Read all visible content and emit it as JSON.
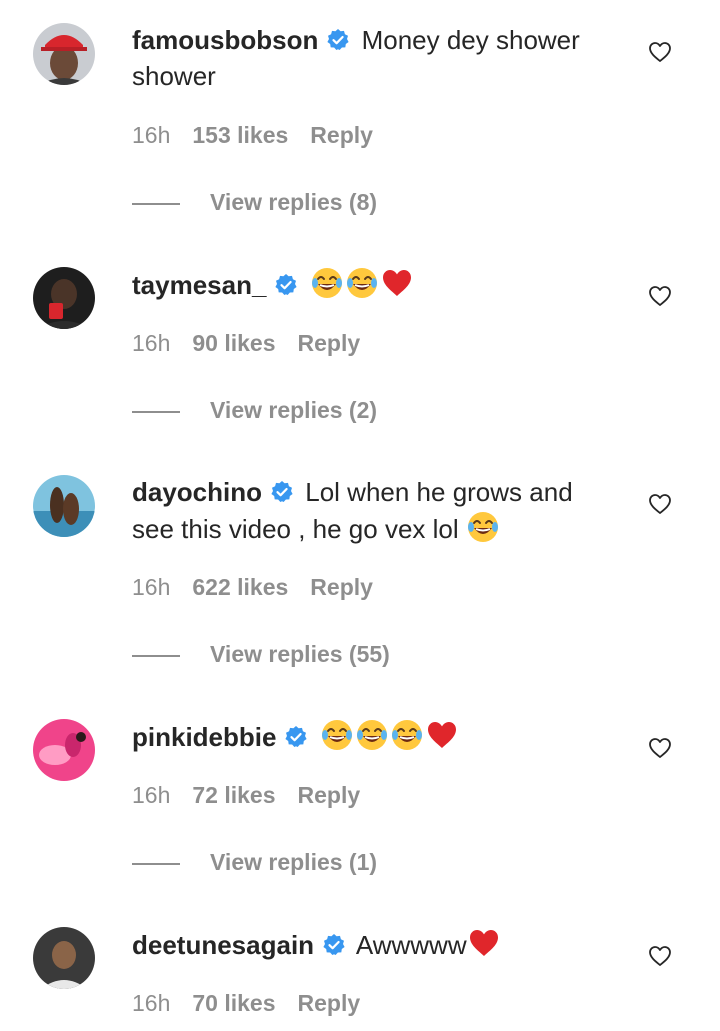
{
  "comments": [
    {
      "username": "famousbobson",
      "text": "Money dey shower shower",
      "emojis": [],
      "time": "16h",
      "likes": "153 likes",
      "reply_label": "Reply",
      "view_replies": "View replies (8)"
    },
    {
      "username": "taymesan_",
      "text": "",
      "emojis": [
        "face-with-tears-of-joy",
        "face-with-tears-of-joy",
        "red-heart"
      ],
      "time": "16h",
      "likes": "90 likes",
      "reply_label": "Reply",
      "view_replies": "View replies (2)"
    },
    {
      "username": "dayochino",
      "text": "Lol when he grows and see this video , he go vex lol",
      "emojis": [
        "face-with-tears-of-joy"
      ],
      "time": "16h",
      "likes": "622 likes",
      "reply_label": "Reply",
      "view_replies": "View replies (55)"
    },
    {
      "username": "pinkidebbie",
      "text": "",
      "emojis": [
        "face-with-tears-of-joy",
        "face-with-tears-of-joy",
        "face-with-tears-of-joy",
        "red-heart"
      ],
      "time": "16h",
      "likes": "72 likes",
      "reply_label": "Reply",
      "view_replies": "View replies (1)"
    },
    {
      "username": "deetunesagain",
      "text": "Awwwww",
      "emojis": [
        "red-heart"
      ],
      "time": "16h",
      "likes": "70 likes",
      "reply_label": "Reply"
    }
  ],
  "icons": {
    "verified": "verified-badge-icon",
    "like": "heart-outline-icon"
  },
  "colors": {
    "verified_blue": "#3897f0",
    "meta_gray": "#8e8e8e",
    "text": "#262626",
    "heart_red": "#e0262b",
    "emoji_yellow": "#ffc83d"
  }
}
